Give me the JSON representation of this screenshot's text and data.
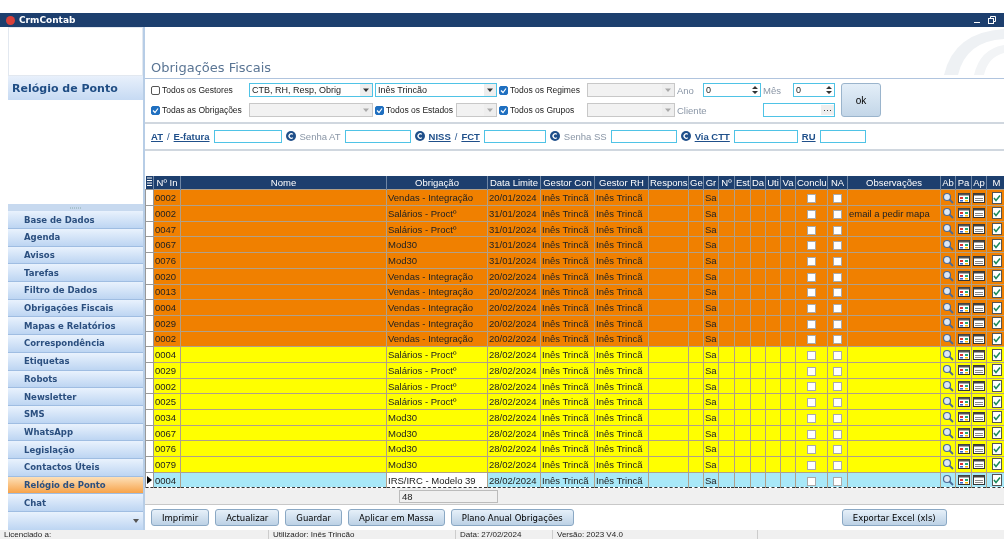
{
  "window": {
    "title": "CrmContab"
  },
  "sidebar": {
    "header": "Relógio de Ponto",
    "items": [
      {
        "label": "Base de Dados",
        "selected": false
      },
      {
        "label": "Agenda",
        "selected": false
      },
      {
        "label": "Avisos",
        "selected": false
      },
      {
        "label": "Tarefas",
        "selected": false
      },
      {
        "label": "Filtro de Dados",
        "selected": false
      },
      {
        "label": "Obrigações Fiscais",
        "selected": false
      },
      {
        "label": "Mapas e Relatórios",
        "selected": false
      },
      {
        "label": "Correspondência",
        "selected": false
      },
      {
        "label": "Etiquetas",
        "selected": false
      },
      {
        "label": "Robots",
        "selected": false
      },
      {
        "label": "Newsletter",
        "selected": false
      },
      {
        "label": "SMS",
        "selected": false
      },
      {
        "label": "WhatsApp",
        "selected": false
      },
      {
        "label": "Legislação",
        "selected": false
      },
      {
        "label": "Contactos Úteis",
        "selected": false
      },
      {
        "label": "Relógio de Ponto",
        "selected": true
      },
      {
        "label": "Chat",
        "selected": false
      }
    ]
  },
  "page_title": "Obrigações Fiscais",
  "filters": {
    "all_managers": {
      "label": "Todos os Gestores",
      "checked": false
    },
    "manager_type": {
      "value": "CTB, RH, Resp, Obrig"
    },
    "manager": {
      "value": "Inês Trincão"
    },
    "all_regimes": {
      "label": "Todos os Regimes",
      "checked": true
    },
    "year": {
      "label": "Ano",
      "value": "0"
    },
    "month": {
      "label": "Mês",
      "value": "0"
    },
    "all_obligations": {
      "label": "Todas as Obrigações",
      "checked": true
    },
    "all_states": {
      "label": "Todos os Estados",
      "checked": true
    },
    "all_groups": {
      "label": "Todos os Grupos",
      "checked": true
    },
    "client": {
      "label": "Cliente",
      "button": "···"
    },
    "ok_button": "ok"
  },
  "credentials": {
    "at_link": "AT",
    "separator": "/",
    "efatura_link": "E-fatura",
    "senha_at": "Senha AT",
    "niss_link": "NISS",
    "fct_link": "FCT",
    "senha_ss": "Senha SS",
    "ctt_link": "Via CTT",
    "ru_link": "RU"
  },
  "table": {
    "columns": [
      "Nº In",
      "Nome",
      "Obrigação",
      "Data Limite",
      "Gestor Con",
      "Gestor RH",
      "Respons",
      "Ge",
      "Gr",
      "Nº",
      "Est",
      "Da",
      "Uti",
      "Va",
      "Conclu",
      "NA",
      "Observações",
      "Ab",
      "Pa",
      "Ap",
      "M"
    ],
    "rows": [
      {
        "id": "0002",
        "obligation": "Vendas - Integração",
        "deadline": "20/01/2024",
        "gestor_con": "Inês Trincã",
        "gestor_rh": "Inês Trincã",
        "group": "Sa",
        "concluded": false,
        "na": false,
        "color": "#f08000",
        "selected": false
      },
      {
        "id": "0002",
        "obligation": "Salários - Proctº",
        "deadline": "31/01/2024",
        "gestor_con": "Inês Trincã",
        "gestor_rh": "Inês Trincã",
        "group": "Sa",
        "concluded": false,
        "na": false,
        "observations": "email a pedir mapa",
        "color": "#f08000",
        "selected": false
      },
      {
        "id": "0047",
        "obligation": "Salários - Proctº",
        "deadline": "31/01/2024",
        "gestor_con": "Inês Trincã",
        "gestor_rh": "Inês Trincã",
        "group": "Sa",
        "concluded": false,
        "na": false,
        "color": "#f08000",
        "selected": false
      },
      {
        "id": "0067",
        "obligation": "Mod30",
        "deadline": "31/01/2024",
        "gestor_con": "Inês Trincã",
        "gestor_rh": "Inês Trincã",
        "group": "Sa",
        "concluded": false,
        "na": false,
        "color": "#f08000",
        "selected": false
      },
      {
        "id": "0076",
        "obligation": "Mod30",
        "deadline": "31/01/2024",
        "gestor_con": "Inês Trincã",
        "gestor_rh": "Inês Trincã",
        "group": "Sa",
        "concluded": false,
        "na": false,
        "color": "#f08000",
        "selected": false
      },
      {
        "id": "0020",
        "obligation": "Vendas - Integração",
        "deadline": "20/02/2024",
        "gestor_con": "Inês Trincã",
        "gestor_rh": "Inês Trincã",
        "group": "Sa",
        "concluded": false,
        "na": false,
        "color": "#f08000",
        "selected": false
      },
      {
        "id": "0013",
        "obligation": "Vendas - Integração",
        "deadline": "20/02/2024",
        "gestor_con": "Inês Trincã",
        "gestor_rh": "Inês Trincã",
        "group": "Sa",
        "concluded": false,
        "na": false,
        "color": "#f08000",
        "selected": false
      },
      {
        "id": "0004",
        "obligation": "Vendas - Integração",
        "deadline": "20/02/2024",
        "gestor_con": "Inês Trincã",
        "gestor_rh": "Inês Trincã",
        "group": "Sa",
        "concluded": false,
        "na": false,
        "color": "#f08000",
        "selected": false
      },
      {
        "id": "0029",
        "obligation": "Vendas - Integração",
        "deadline": "20/02/2024",
        "gestor_con": "Inês Trincã",
        "gestor_rh": "Inês Trincã",
        "group": "Sa",
        "concluded": false,
        "na": false,
        "color": "#f08000",
        "selected": false
      },
      {
        "id": "0002",
        "obligation": "Vendas - Integração",
        "deadline": "20/02/2024",
        "gestor_con": "Inês Trincã",
        "gestor_rh": "Inês Trincã",
        "group": "Sa",
        "concluded": false,
        "na": false,
        "color": "#f08000",
        "selected": false
      },
      {
        "id": "0004",
        "obligation": "Salários - Proctº",
        "deadline": "28/02/2024",
        "gestor_con": "Inês Trincã",
        "gestor_rh": "Inês Trincã",
        "group": "Sa",
        "concluded": false,
        "na": false,
        "color": "#ffff00",
        "selected": false
      },
      {
        "id": "0029",
        "obligation": "Salários - Proctº",
        "deadline": "28/02/2024",
        "gestor_con": "Inês Trincã",
        "gestor_rh": "Inês Trincã",
        "group": "Sa",
        "concluded": false,
        "na": false,
        "color": "#ffff00",
        "selected": false
      },
      {
        "id": "0002",
        "obligation": "Salários - Proctº",
        "deadline": "28/02/2024",
        "gestor_con": "Inês Trincã",
        "gestor_rh": "Inês Trincã",
        "group": "Sa",
        "concluded": false,
        "na": false,
        "color": "#ffff00",
        "selected": false
      },
      {
        "id": "0025",
        "obligation": "Salários - Proctº",
        "deadline": "28/02/2024",
        "gestor_con": "Inês Trincã",
        "gestor_rh": "Inês Trincã",
        "group": "Sa",
        "concluded": false,
        "na": false,
        "color": "#ffff00",
        "selected": false
      },
      {
        "id": "0034",
        "obligation": "Mod30",
        "deadline": "28/02/2024",
        "gestor_con": "Inês Trincã",
        "gestor_rh": "Inês Trincã",
        "group": "Sa",
        "concluded": false,
        "na": false,
        "color": "#ffff00",
        "selected": false
      },
      {
        "id": "0067",
        "obligation": "Mod30",
        "deadline": "28/02/2024",
        "gestor_con": "Inês Trincã",
        "gestor_rh": "Inês Trincã",
        "group": "Sa",
        "concluded": false,
        "na": false,
        "color": "#ffff00",
        "selected": false
      },
      {
        "id": "0076",
        "obligation": "Mod30",
        "deadline": "28/02/2024",
        "gestor_con": "Inês Trincã",
        "gestor_rh": "Inês Trincã",
        "group": "Sa",
        "concluded": false,
        "na": false,
        "color": "#ffff00",
        "selected": false
      },
      {
        "id": "0079",
        "obligation": "Mod30",
        "deadline": "28/02/2024",
        "gestor_con": "Inês Trincã",
        "gestor_rh": "Inês Trincã",
        "group": "Sa",
        "concluded": false,
        "na": false,
        "color": "#ffff00",
        "selected": false
      },
      {
        "id": "0004",
        "obligation": "IRS/IRC - Modelo 39",
        "deadline": "28/02/2024",
        "gestor_con": "Inês Trincã",
        "gestor_rh": "Inês Trincã",
        "group": "Sa",
        "concluded": false,
        "na": false,
        "color": "#a8e8f8",
        "selected": true
      }
    ],
    "count": "48"
  },
  "buttons": [
    "Imprimir",
    "Actualizar",
    "Guardar",
    "Aplicar em Massa",
    "Plano Anual Obrigações"
  ],
  "export_button": "Exportar Excel (xls)",
  "status_bar": [
    "Licenciado a:",
    "Utilizador: Inês Trincão",
    "Data: 27/02/2024",
    "Versão: 2023 V4.0"
  ]
}
